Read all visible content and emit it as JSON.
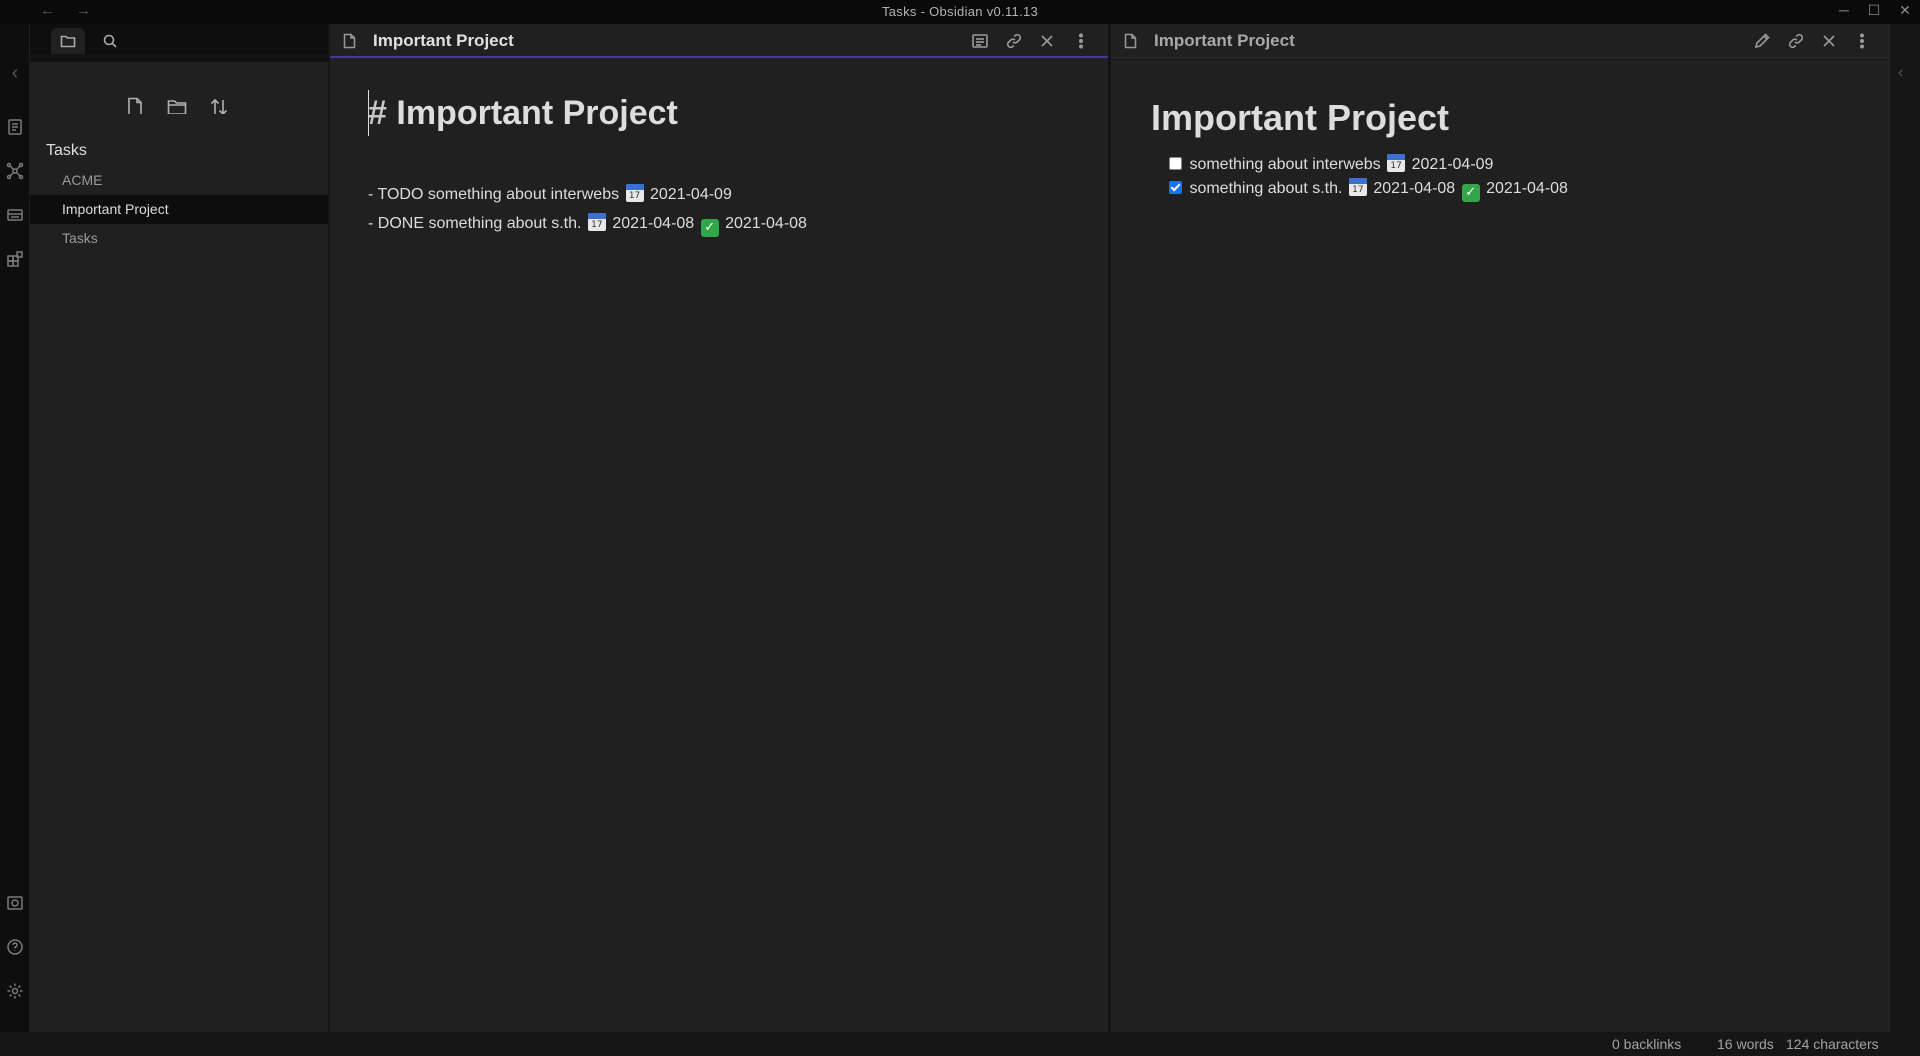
{
  "window": {
    "title": "Tasks - Obsidian v0.11.13",
    "back_glyph": "←",
    "forward_glyph": "→",
    "minimize_glyph": "─",
    "maximize_glyph": "☐",
    "close_glyph": "✕"
  },
  "ribbon": {
    "collapse_glyph": "‹",
    "icons": [
      "collapse-icon",
      "quick-switcher-icon",
      "graph-view-icon",
      "templates-icon",
      "plugins-icon",
      "vault-icon",
      "help-icon",
      "settings-icon"
    ]
  },
  "sidebar": {
    "tabs": [
      "file-explorer-icon",
      "search-icon"
    ],
    "actions": [
      "new-note-icon",
      "new-folder-icon",
      "sort-icon"
    ],
    "vault_name": "Tasks",
    "files": [
      {
        "label": "ACME",
        "active": false
      },
      {
        "label": "Important Project",
        "active": true
      },
      {
        "label": "Tasks",
        "active": false
      }
    ]
  },
  "left_pane": {
    "title": "Important Project",
    "heading_hash": "#",
    "heading_text": "Important Project",
    "lines": [
      {
        "prefix": "- TODO something about interwebs",
        "due_date": "2021-04-09"
      },
      {
        "prefix": "- DONE something about s.th.",
        "due_date": "2021-04-08",
        "done_date": "2021-04-08"
      }
    ]
  },
  "right_pane": {
    "title": "Important Project",
    "heading": "Important Project",
    "tasks": [
      {
        "checked": false,
        "text": "something about interwebs",
        "due_date": "2021-04-09"
      },
      {
        "checked": true,
        "text": "something about s.th.",
        "due_date": "2021-04-08",
        "done_date": "2021-04-08"
      }
    ]
  },
  "right_strip": {
    "expand_glyph": "‹"
  },
  "status": {
    "backlinks": "0 backlinks",
    "words": "16 words",
    "characters": "124 characters"
  },
  "colors": {
    "accent": "#483699",
    "checkbox_checked": "#1a73e8",
    "done_emoji": "#33a64a"
  }
}
